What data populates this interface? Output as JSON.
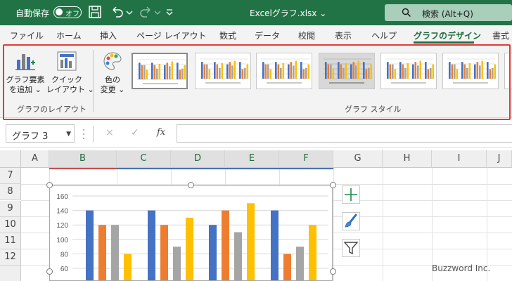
{
  "titlebar": {
    "autosave_label": "自動保存",
    "autosave_state": "オフ",
    "filename": "Excelグラフ.xlsx",
    "filename_chevron": "⌄",
    "search_label": "検索 (Alt+Q)",
    "bg_color": "#217346"
  },
  "tabs": [
    {
      "label": "ファイル",
      "active": false
    },
    {
      "label": "ホーム",
      "active": false
    },
    {
      "label": "挿入",
      "active": false
    },
    {
      "label": "ページ レイアウト",
      "active": false
    },
    {
      "label": "数式",
      "active": false
    },
    {
      "label": "データ",
      "active": false
    },
    {
      "label": "校閲",
      "active": false
    },
    {
      "label": "表示",
      "active": false
    },
    {
      "label": "ヘルプ",
      "active": false
    },
    {
      "label": "グラフのデザイン",
      "active": true
    },
    {
      "label": "書式",
      "active": false
    }
  ],
  "ribbon": {
    "add_element_line1": "グラフ要素",
    "add_element_line2": "を追加 ⌄",
    "quick_layout_line1": "クイック",
    "quick_layout_line2": "レイアウト ⌄",
    "change_color_line1": "色の",
    "change_color_line2": "変更 ⌄",
    "group_layout_label": "グラフのレイアウト",
    "group_style_label": "グラフ スタイル",
    "highlight_color": "#e53935"
  },
  "formula_bar": {
    "name_box": "グラフ 3",
    "cancel_icon": "×",
    "enter_icon": "✓",
    "fx_label": "fx",
    "value": ""
  },
  "grid": {
    "columns": [
      "A",
      "B",
      "C",
      "D",
      "E",
      "F",
      "G",
      "H",
      "I",
      "J"
    ],
    "rows": [
      "7",
      "8",
      "9",
      "10",
      "11",
      "12"
    ]
  },
  "chart_data": {
    "type": "bar",
    "ylim": [
      0,
      160
    ],
    "y_ticks": [
      "160",
      "140",
      "120",
      "100",
      "80",
      "60",
      "40"
    ],
    "categories": [
      "",
      "",
      "",
      ""
    ],
    "series": [
      {
        "color": "#4472c4",
        "values": [
          140,
          140,
          120,
          140
        ]
      },
      {
        "color": "#ed7d31",
        "values": [
          120,
          120,
          140,
          80
        ]
      },
      {
        "color": "#a5a5a5",
        "values": [
          120,
          90,
          110,
          90
        ]
      },
      {
        "color": "#ffc000",
        "values": [
          80,
          130,
          150,
          120
        ]
      }
    ],
    "grid": true
  },
  "chart_tools": {
    "elements_icon": "plus-icon",
    "styles_icon": "brush-icon",
    "filter_icon": "filter-icon"
  },
  "watermark": "Buzzword Inc."
}
